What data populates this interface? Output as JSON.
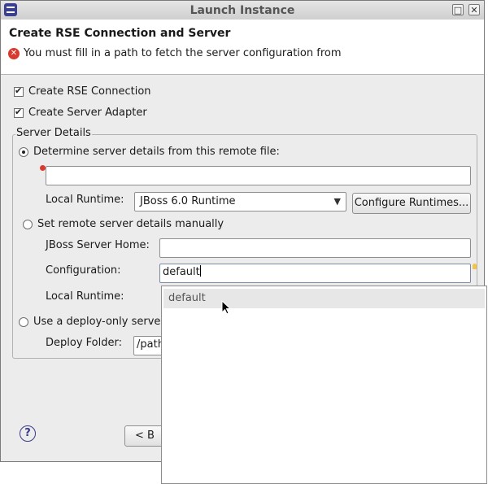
{
  "window": {
    "title": "Launch Instance"
  },
  "header": {
    "title": "Create RSE Connection and Server",
    "error_message": "You must fill in a path to fetch the server configuration from"
  },
  "options": {
    "create_rse_connection": {
      "label": "Create RSE Connection",
      "checked": true
    },
    "create_server_adapter": {
      "label": "Create Server Adapter",
      "checked": true
    }
  },
  "server_details": {
    "group_label": "Server Details",
    "remote_file_option": "Determine server details from this remote file:",
    "remote_file_path": "",
    "local_runtime_label": "Local Runtime:",
    "local_runtime_value": "JBoss 6.0 Runtime",
    "configure_runtimes_label": "Configure Runtimes...",
    "manual_option": "Set remote server details manually",
    "jboss_home_label": "JBoss Server Home:",
    "jboss_home_value": "",
    "configuration_label": "Configuration:",
    "configuration_value": "default",
    "manual_local_runtime_label": "Local Runtime:",
    "deploy_only_option": "Use a deploy-only serve",
    "deploy_folder_label": "Deploy Folder:",
    "deploy_folder_value": "/path"
  },
  "footer": {
    "back_label": "< B"
  },
  "autocomplete": {
    "items": [
      "default"
    ]
  },
  "icons": [
    "app-icon",
    "error-icon",
    "help-icon",
    "mouse-cursor-icon",
    "content-assist-bulb-icon"
  ],
  "colors": {
    "error": "#d93a2f",
    "window_bg": "#ececec",
    "popup_highlight": "#e7e7e7"
  }
}
